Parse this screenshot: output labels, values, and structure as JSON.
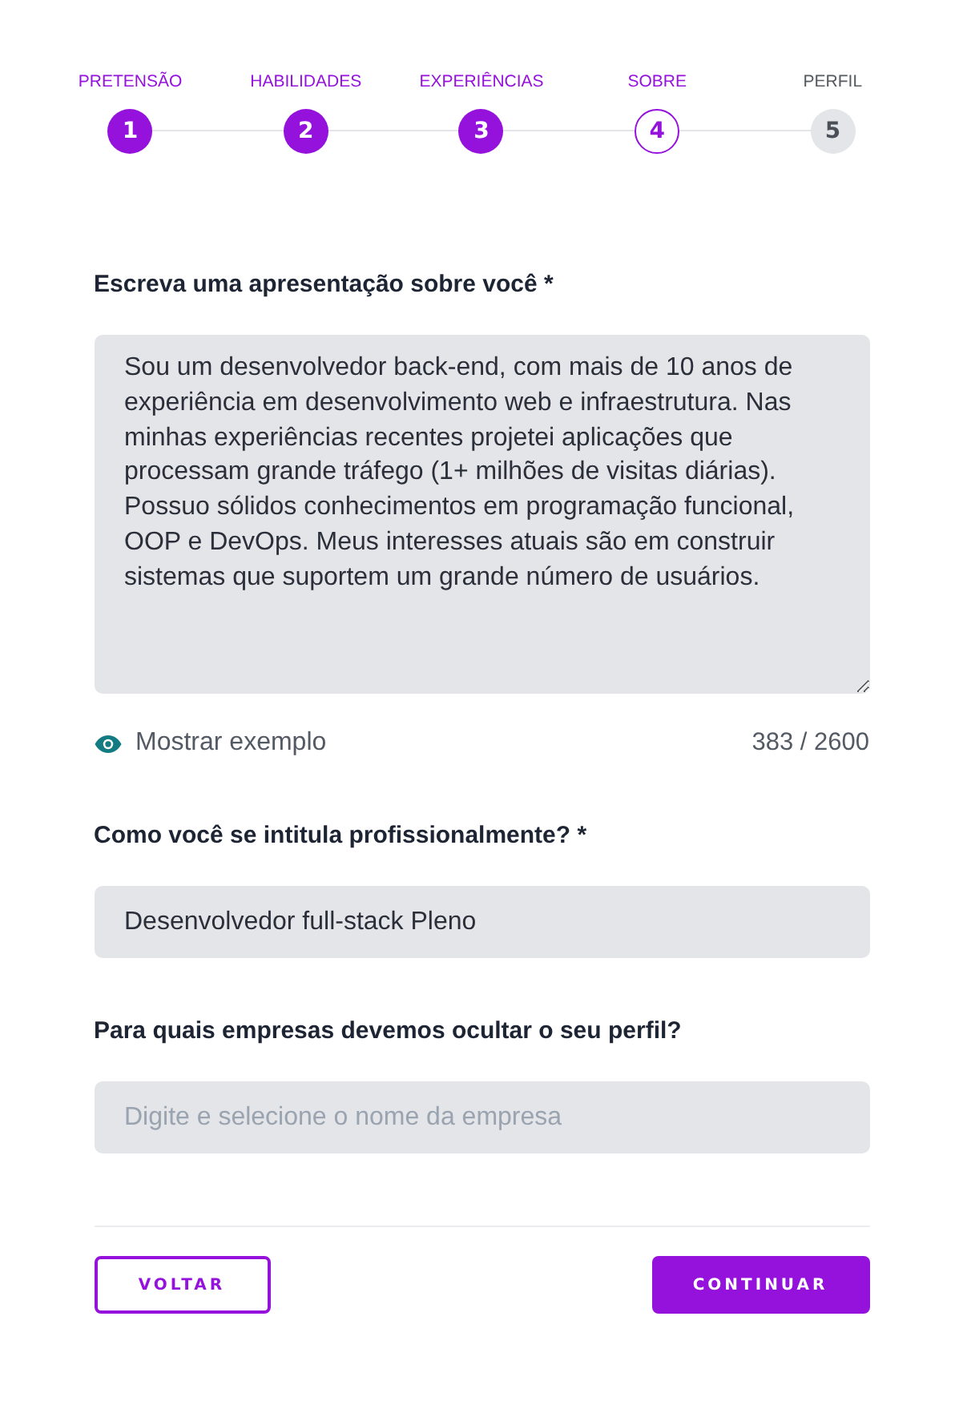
{
  "steps": [
    {
      "number": "1",
      "label": "PRETENSÃO",
      "completed": true,
      "selected": false
    },
    {
      "number": "2",
      "label": "HABILIDADES",
      "completed": true,
      "selected": false
    },
    {
      "number": "3",
      "label": "EXPERIÊNCIAS",
      "completed": true,
      "selected": false
    },
    {
      "number": "4",
      "label": "SOBRE",
      "completed": false,
      "selected": true
    },
    {
      "number": "5",
      "label": "PERFIL",
      "completed": false,
      "selected": false
    }
  ],
  "about": {
    "label": "Escreva uma apresentação sobre você *",
    "value": "Sou um desenvolvedor back-end, com mais de 10 anos de experiência em desenvolvimento web e infraestrutura. Nas minhas experiências recentes projetei aplicações que processam grande tráfego (1+ milhões de visitas diárias). Possuo sólidos conhecimentos em programação funcional, OOP e DevOps. Meus interesses atuais são em construir sistemas que suportem um grande número de usuários.",
    "show_example": "Mostrar exemplo",
    "counter": "383 / 2600"
  },
  "title_field": {
    "label": "Como você se intitula profissionalmente? *",
    "value": "Desenvolvedor full-stack Pleno"
  },
  "hidden_companies": {
    "label": "Para quais empresas devemos ocultar o seu perfil?",
    "placeholder": "Digite e selecione o nome da empresa"
  },
  "buttons": [
    {
      "label": "VOLTAR",
      "kind": "secondary"
    },
    {
      "label": "CONTINUAR",
      "kind": "primary"
    }
  ]
}
